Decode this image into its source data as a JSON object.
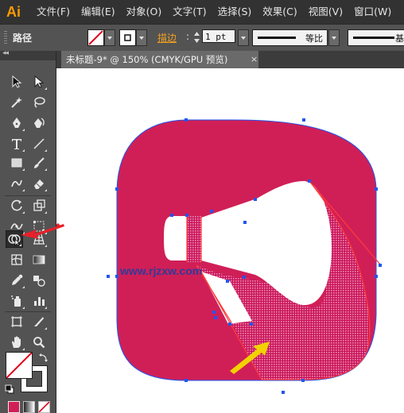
{
  "app": {
    "logo": "Ai"
  },
  "menu": [
    "文件(F)",
    "编辑(E)",
    "对象(O)",
    "文字(T)",
    "选择(S)",
    "效果(C)",
    "视图(V)",
    "窗口(W)"
  ],
  "control_bar": {
    "selection_type": "路径",
    "stroke_label": "描边",
    "stroke_colon": ":",
    "stroke_weight": "1 pt",
    "profile_label": "等比",
    "brush_label": "基"
  },
  "document": {
    "tab_title": "未标题-9* @ 150% (CMYK/GPU 预览)",
    "close_glyph": "×"
  },
  "canvas": {
    "watermark": "www.rjzxw.com",
    "icon_color": "#d01f57",
    "selection_color": "#2255ee"
  },
  "toolbar": {
    "collapse_glyph": "◂◂",
    "tools": [
      "selection-tool",
      "direct-selection-tool",
      "magic-wand-tool",
      "lasso-tool",
      "pen-tool",
      "curvature-tool",
      "type-tool",
      "line-segment-tool",
      "rectangle-tool",
      "paintbrush-tool",
      "shaper-tool",
      "eraser-tool",
      "rotate-tool",
      "scale-tool",
      "width-tool",
      "free-transform-tool",
      "shape-builder-tool",
      "perspective-grid-tool",
      "mesh-tool",
      "gradient-tool",
      "eyedropper-tool",
      "blend-tool",
      "symbol-sprayer-tool",
      "column-graph-tool",
      "artboard-tool",
      "slice-tool",
      "hand-tool",
      "zoom-tool"
    ],
    "active_tool": "shape-builder-tool"
  }
}
